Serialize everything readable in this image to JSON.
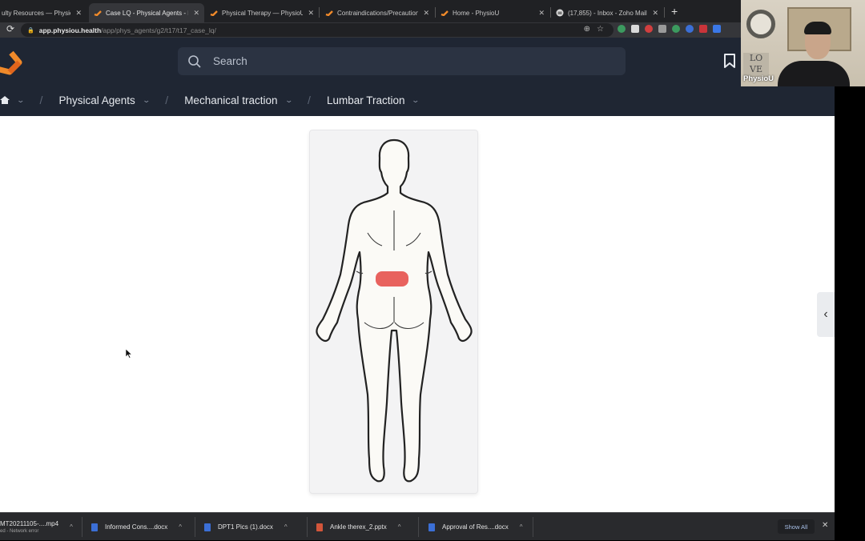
{
  "browser": {
    "tabs": [
      {
        "title": "ulty Resources — PhysioU",
        "active": false,
        "favicon": "physiou-logo-icon"
      },
      {
        "title": "Case LQ - Physical Agents - P",
        "active": true,
        "favicon": "physiou-logo-icon"
      },
      {
        "title": "Physical Therapy — PhysioU",
        "active": false,
        "favicon": "physiou-logo-icon"
      },
      {
        "title": "Contraindications/Precautions",
        "active": false,
        "favicon": "physiou-logo-icon"
      },
      {
        "title": "Home - PhysioU",
        "active": false,
        "favicon": "physiou-logo-icon"
      },
      {
        "title": "(17,855) - Inbox - Zoho Mail (",
        "active": false,
        "favicon": "zoho-mail-icon"
      }
    ],
    "close_glyph": "✕",
    "new_tab_glyph": "+",
    "url_host": "app.physiou.health",
    "url_path": "/app/phys_agents/g2/t17/t17_case_lq/",
    "extension_colors": [
      "#3c9a5f",
      "#d9d9d9",
      "#d23f3f",
      "#9a9a9a",
      "#3c9a5f",
      "#3b6fd6",
      "#c9343a",
      "#3b78e7"
    ]
  },
  "app": {
    "search_placeholder": "Search",
    "brand_color": "#f08a2a",
    "breadcrumb": [
      {
        "label": "Physical Agents"
      },
      {
        "label": "Mechanical traction"
      },
      {
        "label": "Lumbar Traction"
      }
    ],
    "breadcrumb_separator": "/",
    "breadcrumb_chevron": "⌄",
    "figure": {
      "description": "Posterior body chart",
      "highlight_region": "lumbar",
      "highlight_color": "#e8625e"
    },
    "side_toggle_glyph": "‹"
  },
  "video": {
    "label": "PhysioU",
    "sign_text": "LO VE"
  },
  "downloads": {
    "items": [
      {
        "name": "MT20211105-....mp4",
        "status": "ed - Network error",
        "color": "#888888"
      },
      {
        "name": "Informed Cons....docx",
        "color": "#3b6fd6"
      },
      {
        "name": "DPT1 Pics (1).docx",
        "color": "#3b6fd6"
      },
      {
        "name": "Ankle therex_2.pptx",
        "color": "#d2553a"
      },
      {
        "name": "Approval of Res....docx",
        "color": "#3b6fd6"
      }
    ],
    "caret_glyph": "^",
    "show_all_label": "Show All",
    "close_glyph": "✕"
  }
}
